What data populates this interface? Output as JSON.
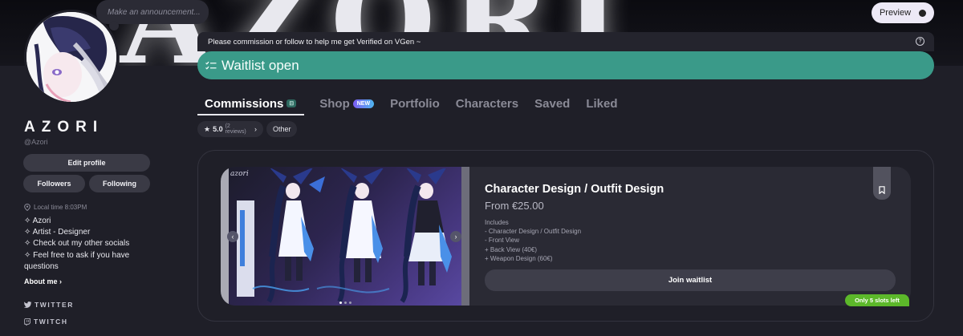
{
  "banner": {
    "art_text": "AZORI",
    "preview_label": "Preview"
  },
  "announcement": {
    "placeholder": "Make an announcement..."
  },
  "profile": {
    "name": "AZORI",
    "handle": "@Azori",
    "edit_label": "Edit profile",
    "followers_label": "Followers",
    "following_label": "Following",
    "local_time": "Local time 8:03PM",
    "bio": [
      "✧ Azori",
      "✧ Artist - Designer",
      "✧ Check out my other socials",
      "✧ Feel free to ask if you have questions"
    ],
    "about_me": "About me",
    "socials": [
      "TWITTER",
      "TWITCH"
    ]
  },
  "notice": {
    "text": "Please commission or follow to help me get Verified on VGen ~",
    "help_icon": "?"
  },
  "waitlist": {
    "label": "Waitlist open"
  },
  "tabs": [
    {
      "label": "Commissions",
      "badge": "⊟",
      "active": true
    },
    {
      "label": "Shop",
      "badge": "NEW"
    },
    {
      "label": "Portfolio"
    },
    {
      "label": "Characters"
    },
    {
      "label": "Saved"
    },
    {
      "label": "Liked"
    }
  ],
  "filters": {
    "rating": "5.0",
    "reviews": "(2 reviews)",
    "other": "Other"
  },
  "commission": {
    "image_logo": "azori",
    "title": "Character Design / Outfit Design",
    "price": "From €25.00",
    "includes": [
      "Includes",
      "- Character Design / Outfit Design",
      "- Front View",
      "+ Back View (40€)",
      "+ Weapon Design (60€)"
    ],
    "join_label": "Join waitlist",
    "slots_label": "Only 5 slots left"
  },
  "colors": {
    "background": "#1f1f28",
    "accent_teal": "#3a9a89",
    "slots_green": "#5cb82a"
  }
}
